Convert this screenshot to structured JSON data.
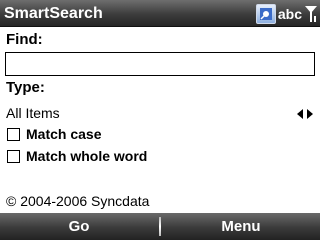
{
  "titlebar": {
    "title": "SmartSearch",
    "input_mode": "abc",
    "icons": [
      "sync-status-icon",
      "signal-strength-icon"
    ]
  },
  "form": {
    "find_label": "Find:",
    "find_value": "",
    "type_label": "Type:",
    "type_selected": "All Items",
    "match_case_label": "Match case",
    "match_case_checked": false,
    "whole_word_label": "Match whole word",
    "whole_word_checked": false
  },
  "footer": {
    "copyright": "© 2004-2006 Syncdata"
  },
  "softkeys": {
    "left": "Go",
    "right": "Menu"
  }
}
